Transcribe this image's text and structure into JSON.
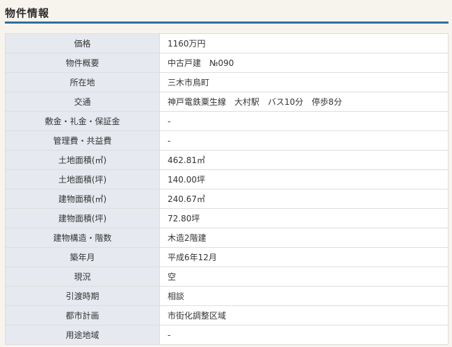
{
  "heading": "物件情報",
  "rows": [
    {
      "label": "価格",
      "value": "1160万円"
    },
    {
      "label": "物件概要",
      "value": "中古戸建　№090"
    },
    {
      "label": "所在地",
      "value": "三木市鳥町"
    },
    {
      "label": "交通",
      "value": "神戸電鉄粟生線　大村駅　バス10分　停歩8分"
    },
    {
      "label": "敷金・礼金・保証金",
      "value": "-"
    },
    {
      "label": "管理費・共益費",
      "value": "-"
    },
    {
      "label": "土地面積(㎡)",
      "value": "462.81㎡"
    },
    {
      "label": "土地面積(坪)",
      "value": "140.00坪"
    },
    {
      "label": "建物面積(㎡)",
      "value": "240.67㎡"
    },
    {
      "label": "建物面積(坪)",
      "value": "72.80坪"
    },
    {
      "label": "建物構造・階数",
      "value": "木造2階建"
    },
    {
      "label": "築年月",
      "value": "平成6年12月"
    },
    {
      "label": "現況",
      "value": "空"
    },
    {
      "label": "引渡時期",
      "value": "相談"
    },
    {
      "label": "都市計画",
      "value": "市街化調整区域"
    },
    {
      "label": "用途地域",
      "value": "-"
    }
  ],
  "colors": {
    "accent_line": "#2e6f9e",
    "header_cell_bg": "#e6e9ef",
    "page_bg": "#f7f4ee"
  }
}
